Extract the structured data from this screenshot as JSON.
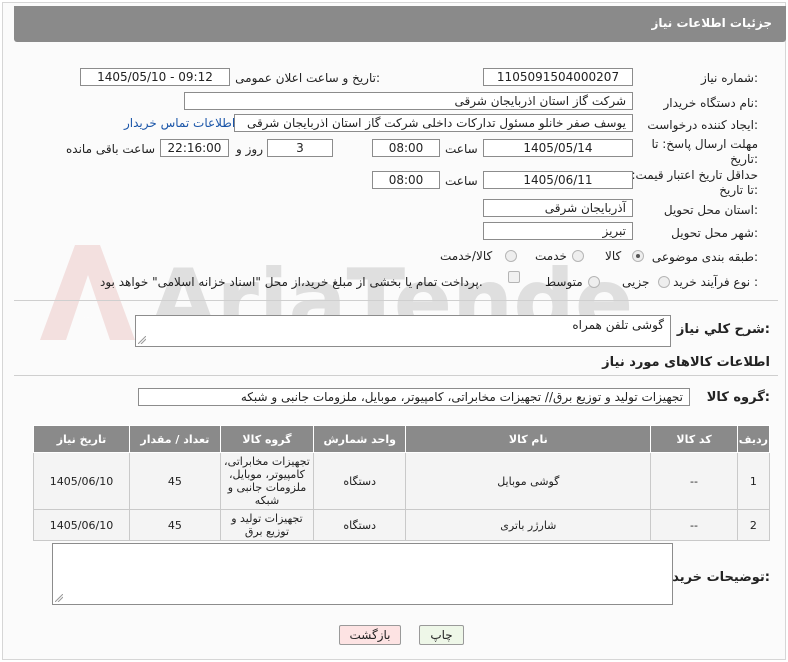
{
  "header": {
    "title": "جزئیات اطلاعات نیاز"
  },
  "watermark": {
    "text": "AriaTender.neT"
  },
  "fields": {
    "need_number_label": "شماره نیاز:",
    "need_number": "1105091504000207",
    "announce_label": "تاریخ و ساعت اعلان عمومی:",
    "announce_value": "1405/05/10 - 09:12",
    "buyer_org_label": "نام دستگاه خریدار:",
    "buyer_org": "شرکت گاز استان اذربایجان شرقی",
    "creator_label": "ایجاد کننده درخواست:",
    "creator": "یوسف صفر خانلو  مسئول تدارکات داخلی  شرکت گاز استان اذربایجان شرقی",
    "contact_link": "اطلاعات تماس خریدار",
    "deadline_label": "مهلت ارسال پاسخ: تا تاریخ:",
    "deadline_date": "1405/05/14",
    "time_label": "ساعت",
    "deadline_time": "08:00",
    "days_value": "3",
    "days_label": "روز و",
    "remaining_time": "22:16:00",
    "remaining_label": "ساعت باقی مانده",
    "validity_label": "حداقل تاریخ اعتبار قیمت: تا تاریخ:",
    "validity_date": "1405/06/11",
    "validity_time": "08:00",
    "province_label": "استان محل تحویل:",
    "province": "آذربایجان شرقی",
    "city_label": "شهر محل تحویل:",
    "city": "تبریز",
    "category_label": "طبقه بندی موضوعی:",
    "category_options": [
      "کالا",
      "خدمت",
      "کالا/خدمت"
    ],
    "process_label": "نوع فرآیند خرید :",
    "process_options": [
      "جزیی",
      "متوسط"
    ],
    "payment_note": "پرداخت تمام یا بخشی از مبلغ خرید،از محل \"اسناد خزانه اسلامی\" خواهد بود."
  },
  "description": {
    "label": "شرح کلي نياز:",
    "value": "گوشی تلفن همراه"
  },
  "goods_info_title": "اطلاعات کالاهای مورد نیاز",
  "goods_group": {
    "label": "گروه کالا:",
    "value": "تجهیزات تولید و توزیع برق// تجهیزات مخابراتی، کامپیوتر، موبایل، ملزومات جانبی و شبکه"
  },
  "table": {
    "headers": [
      "ردیف",
      "کد کالا",
      "نام کالا",
      "واحد شمارش",
      "گروه کالا",
      "تعداد / مقدار",
      "تاریخ نیاز"
    ],
    "rows": [
      [
        "1",
        "--",
        "گوشی موبایل",
        "دستگاه",
        "تجهیزات مخابراتی، کامپیوتر، موبایل، ملزومات جانبی و شبکه",
        "45",
        "1405/06/10"
      ],
      [
        "2",
        "--",
        "شارژر باتری",
        "دستگاه",
        "تجهیزات تولید و توزیع برق",
        "45",
        "1405/06/10"
      ]
    ]
  },
  "buyer_notes": {
    "label": "توضیحات خریدار:",
    "value": ""
  },
  "buttons": {
    "print": "چاپ",
    "back": "بازگشت"
  },
  "colors": {
    "header_bg": "#8a8a8a",
    "link": "#1a55a8",
    "back_button": "#fde3e3",
    "print_button": "#eef7e8"
  }
}
